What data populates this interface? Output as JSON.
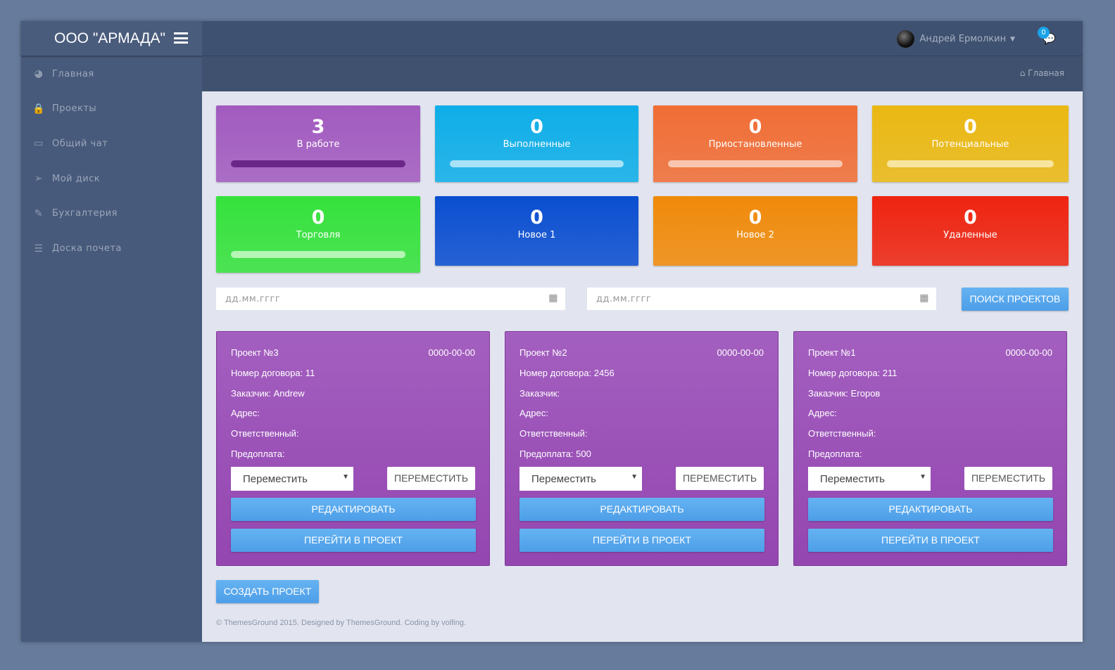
{
  "brand": {
    "title": "ООО \"АРМАДА\""
  },
  "sidebar": {
    "items": [
      {
        "label": "Главная",
        "icon": "dashboard-icon"
      },
      {
        "label": "Проекты",
        "icon": "lock-icon"
      },
      {
        "label": "Общий чат",
        "icon": "desktop-icon"
      },
      {
        "label": "Мой диск",
        "icon": "paper-plane-icon"
      },
      {
        "label": "Бухгалтерия",
        "icon": "edit-icon"
      },
      {
        "label": "Доска почета",
        "icon": "list-icon"
      }
    ]
  },
  "header": {
    "user": "Андрей Ермолкин",
    "chat_count": "0"
  },
  "breadcrumb": {
    "label": "Главная"
  },
  "stats": [
    {
      "value": "3",
      "label": "В работе",
      "color": "#a25bbf",
      "bar": "#6a2788"
    },
    {
      "value": "0",
      "label": "Выполненные",
      "color": "#0eaee8",
      "bar": "#a8e2f8"
    },
    {
      "value": "0",
      "label": "Приостановленные",
      "color": "#f06d35",
      "bar": "#f9c5ae"
    },
    {
      "value": "0",
      "label": "Потенциальные",
      "color": "#eab812",
      "bar": "#f7e5a0"
    },
    {
      "value": "0",
      "label": "Торговля",
      "color": "#35e23c",
      "bar": "#b5f5b5"
    },
    {
      "value": "0",
      "label": "Новое 1",
      "color": "#0a4ed0"
    },
    {
      "value": "0",
      "label": "Новое 2",
      "color": "#f08a0a"
    },
    {
      "value": "0",
      "label": "Удаленные",
      "color": "#ee2410"
    }
  ],
  "search": {
    "date_from_placeholder": "дд.мм.гггг",
    "date_to_placeholder": "дд.мм.гггг",
    "button": "ПОИСК ПРОЕКТОВ"
  },
  "projects": [
    {
      "title": "Проект №3",
      "date": "0000-00-00",
      "contract": "Номер договора: 11",
      "customer": "Заказчик: Andrew",
      "address": "Адрес:",
      "responsible": "Ответственный:",
      "prepay": "Предоплата:"
    },
    {
      "title": "Проект №2",
      "date": "0000-00-00",
      "contract": "Номер договора: 2456",
      "customer": "Заказчик:",
      "address": "Адрес:",
      "responsible": "Ответственный:",
      "prepay": "Предоплата: 500"
    },
    {
      "title": "Проект №1",
      "date": "0000-00-00",
      "contract": "Номер договора: 211",
      "customer": "Заказчик: Егоров",
      "address": "Адрес:",
      "responsible": "Ответственный:",
      "prepay": "Предоплата:"
    }
  ],
  "card_actions": {
    "select_value": "Переместить",
    "move": "ПЕРЕМЕСТИТЬ",
    "edit": "РЕДАКТИРОВАТЬ",
    "open": "ПЕРЕЙТИ В ПРОЕКТ"
  },
  "create_button": "СОЗДАТЬ ПРОЕКТ",
  "footer": "© ThemesGround 2015. Designed by ThemesGround. Coding by volfing."
}
